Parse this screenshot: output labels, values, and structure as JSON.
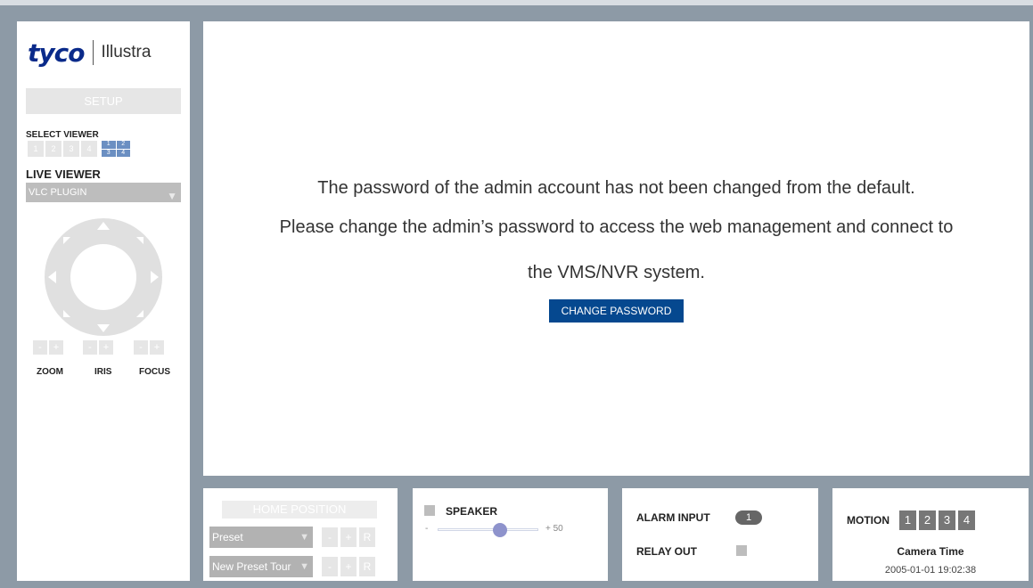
{
  "brand": {
    "name": "tyco",
    "product": "Illustra"
  },
  "sidebar": {
    "setup_label": "SETUP",
    "select_viewer_label": "SELECT VIEWER",
    "viewer_buttons": [
      "1",
      "2",
      "3",
      "4"
    ],
    "viewer_quad": [
      "1",
      "2",
      "3",
      "4"
    ],
    "live_viewer_label": "LIVE VIEWER",
    "live_viewer_selected": "VLC PLUGIN",
    "zoom_label": "ZOOM",
    "iris_label": "IRIS",
    "focus_label": "FOCUS",
    "minus": "-",
    "plus": "+"
  },
  "main": {
    "line1": "The password of the admin account has not been changed from the default.",
    "line2": "Please change the admin’s password to access the web management and connect to",
    "line3": "the VMS/NVR system.",
    "change_password_label": "CHANGE PASSWORD"
  },
  "preset_panel": {
    "home_position_label": "HOME POSITION",
    "preset_selected": "Preset",
    "tour_selected": "New Preset Tour",
    "minus": "-",
    "plus": "+",
    "reset": "R"
  },
  "speaker_panel": {
    "label": "SPEAKER",
    "min_label": "-",
    "max_label": "+ 50",
    "volume_fraction": 0.62
  },
  "io_panel": {
    "alarm_input_label": "ALARM INPUT",
    "alarm_input_value": "1",
    "relay_out_label": "RELAY OUT"
  },
  "motion_panel": {
    "label": "MOTION",
    "buttons": [
      "1",
      "2",
      "3",
      "4"
    ],
    "camera_time_label": "Camera Time",
    "camera_time_value": "2005-01-01 19:02:38"
  },
  "colors": {
    "background": "#8d9aa6",
    "accent_blue": "#05488f",
    "brand_blue": "#0a2a8a"
  }
}
